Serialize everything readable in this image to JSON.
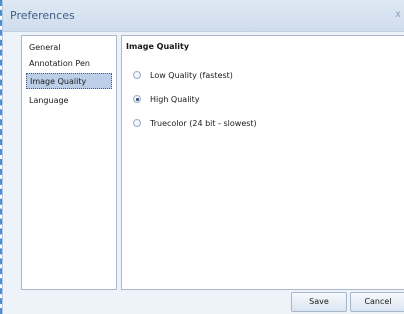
{
  "window": {
    "title": "Preferences",
    "close_glyph": "x"
  },
  "sidebar": {
    "items": [
      {
        "label": "General",
        "selected": false
      },
      {
        "label": "Annotation Pen",
        "selected": false
      },
      {
        "label": "Image Quality",
        "selected": true
      },
      {
        "label": "Language",
        "selected": false
      }
    ]
  },
  "content": {
    "section_title": "Image Quality",
    "options": [
      {
        "label": "Low Quality (fastest)",
        "checked": false
      },
      {
        "label": "High Quality",
        "checked": true
      },
      {
        "label": "Truecolor (24 bit - slowest)",
        "checked": false
      }
    ]
  },
  "buttons": {
    "save_label": "Save",
    "cancel_label": "Cancel"
  },
  "colors": {
    "selection": "#bdcfe8",
    "title_text": "#3f5f86",
    "frame_border": "#a9b8ca"
  }
}
